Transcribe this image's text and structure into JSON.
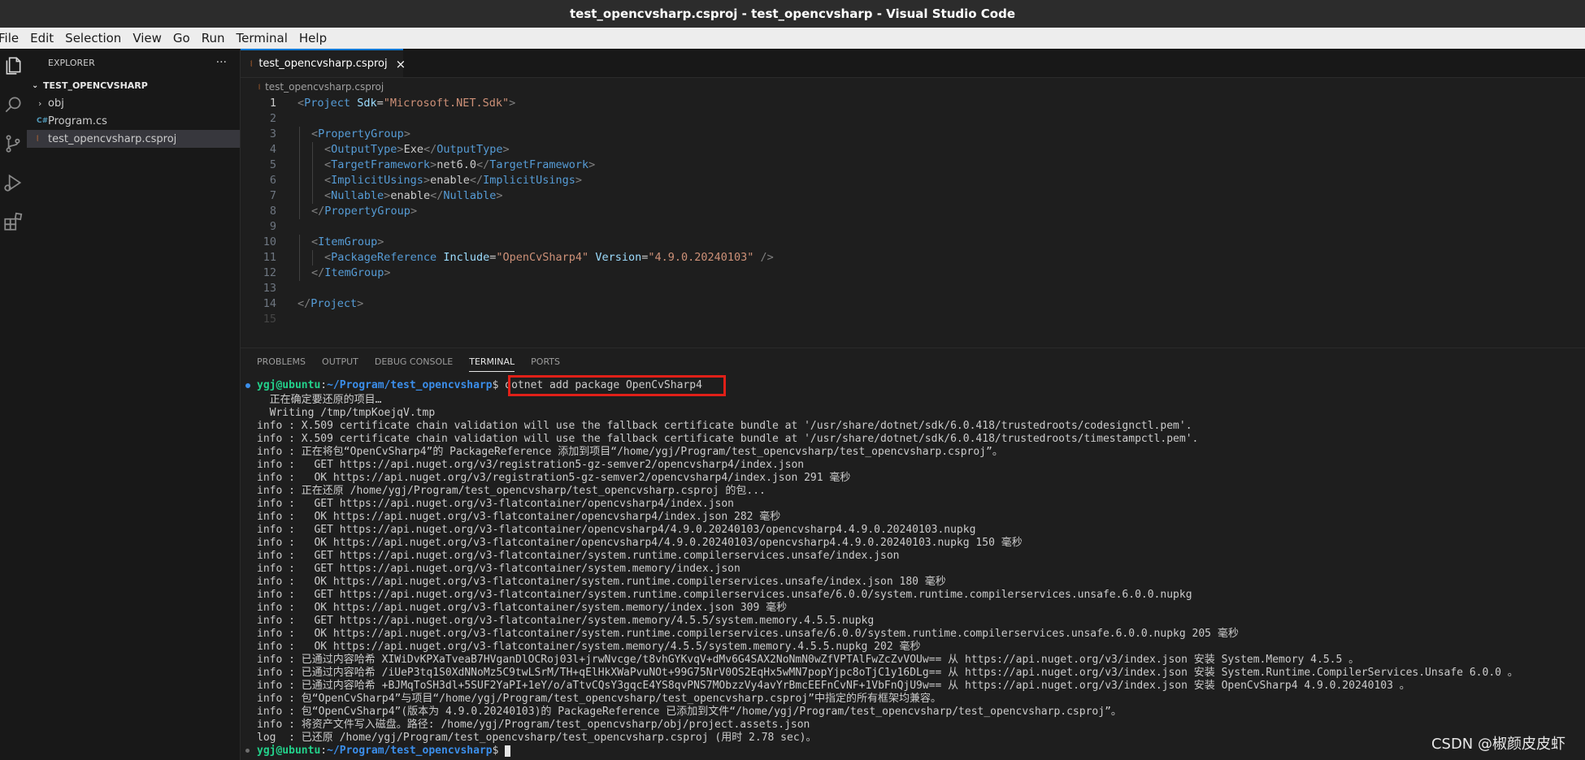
{
  "window": {
    "title": "test_opencvsharp.csproj - test_opencvsharp - Visual Studio Code"
  },
  "menu": [
    "File",
    "Edit",
    "Selection",
    "View",
    "Go",
    "Run",
    "Terminal",
    "Help"
  ],
  "activity_bar": [
    "files-icon",
    "search-icon",
    "source-control-icon",
    "run-debug-icon",
    "extensions-icon"
  ],
  "explorer": {
    "title": "EXPLORER",
    "more": "···",
    "project": "TEST_OPENCVSHARP",
    "items": [
      {
        "label": "obj",
        "icon": "chevron-right-icon"
      },
      {
        "label": "Program.cs",
        "icon": "csharp-file-icon"
      },
      {
        "label": "test_opencvsharp.csproj",
        "icon": "rss-file-icon"
      }
    ]
  },
  "editor": {
    "tab_label": "test_opencvsharp.csproj",
    "tab_close": "×",
    "breadcrumb": "test_opencvsharp.csproj",
    "lines": [
      {
        "n": "1",
        "active": true
      },
      {
        "n": "2"
      },
      {
        "n": "3"
      },
      {
        "n": "4"
      },
      {
        "n": "5"
      },
      {
        "n": "6"
      },
      {
        "n": "7"
      },
      {
        "n": "8"
      },
      {
        "n": "9"
      },
      {
        "n": "10"
      },
      {
        "n": "11"
      },
      {
        "n": "12"
      },
      {
        "n": "13"
      },
      {
        "n": "14"
      },
      {
        "n": "15"
      }
    ],
    "code": {
      "l1_tag": "Project",
      "l1_attr": "Sdk",
      "l1_val": "\"Microsoft.NET.Sdk\"",
      "l3_tag": "PropertyGroup",
      "l4_tag": "OutputType",
      "l4_text": "Exe",
      "l5_tag": "TargetFramework",
      "l5_text": "net6.0",
      "l6_tag": "ImplicitUsings",
      "l6_text": "enable",
      "l7_tag": "Nullable",
      "l7_text": "enable",
      "l8_tag": "PropertyGroup",
      "l10_tag": "ItemGroup",
      "l11_tag": "PackageReference",
      "l11_attr1": "Include",
      "l11_val1": "\"OpenCvSharp4\"",
      "l11_attr2": "Version",
      "l11_val2": "\"4.9.0.20240103\"",
      "l12_tag": "ItemGroup",
      "l14_tag": "Project"
    }
  },
  "panel": {
    "tabs": [
      "PROBLEMS",
      "OUTPUT",
      "DEBUG CONSOLE",
      "TERMINAL",
      "PORTS"
    ],
    "active_tab": "TERMINAL"
  },
  "terminal": {
    "prompt_user": "ygj@ubuntu",
    "prompt_path": "~/Program/test_opencvsharp",
    "prompt_sym": "$ ",
    "command": "dotnet add package OpenCvSharp4",
    "output": [
      "  正在确定要还原的项目…",
      "  Writing /tmp/tmpKoejqV.tmp",
      "info : X.509 certificate chain validation will use the fallback certificate bundle at '/usr/share/dotnet/sdk/6.0.418/trustedroots/codesignctl.pem'.",
      "info : X.509 certificate chain validation will use the fallback certificate bundle at '/usr/share/dotnet/sdk/6.0.418/trustedroots/timestampctl.pem'.",
      "info : 正在将包“OpenCvSharp4”的 PackageReference 添加到项目“/home/ygj/Program/test_opencvsharp/test_opencvsharp.csproj”。",
      "info :   GET https://api.nuget.org/v3/registration5-gz-semver2/opencvsharp4/index.json",
      "info :   OK https://api.nuget.org/v3/registration5-gz-semver2/opencvsharp4/index.json 291 毫秒",
      "info : 正在还原 /home/ygj/Program/test_opencvsharp/test_opencvsharp.csproj 的包...",
      "info :   GET https://api.nuget.org/v3-flatcontainer/opencvsharp4/index.json",
      "info :   OK https://api.nuget.org/v3-flatcontainer/opencvsharp4/index.json 282 毫秒",
      "info :   GET https://api.nuget.org/v3-flatcontainer/opencvsharp4/4.9.0.20240103/opencvsharp4.4.9.0.20240103.nupkg",
      "info :   OK https://api.nuget.org/v3-flatcontainer/opencvsharp4/4.9.0.20240103/opencvsharp4.4.9.0.20240103.nupkg 150 毫秒",
      "info :   GET https://api.nuget.org/v3-flatcontainer/system.runtime.compilerservices.unsafe/index.json",
      "info :   GET https://api.nuget.org/v3-flatcontainer/system.memory/index.json",
      "info :   OK https://api.nuget.org/v3-flatcontainer/system.runtime.compilerservices.unsafe/index.json 180 毫秒",
      "info :   GET https://api.nuget.org/v3-flatcontainer/system.runtime.compilerservices.unsafe/6.0.0/system.runtime.compilerservices.unsafe.6.0.0.nupkg",
      "info :   OK https://api.nuget.org/v3-flatcontainer/system.memory/index.json 309 毫秒",
      "info :   GET https://api.nuget.org/v3-flatcontainer/system.memory/4.5.5/system.memory.4.5.5.nupkg",
      "info :   OK https://api.nuget.org/v3-flatcontainer/system.runtime.compilerservices.unsafe/6.0.0/system.runtime.compilerservices.unsafe.6.0.0.nupkg 205 毫秒",
      "info :   OK https://api.nuget.org/v3-flatcontainer/system.memory/4.5.5/system.memory.4.5.5.nupkg 202 毫秒",
      "info : 已通过内容哈希 XIWiDvKPXaTveaB7HVganDlOCRoj03l+jrwNvcge/t8vhGYKvqV+dMv6G4SAX2NoNmN0wZfVPTAlFwZcZvVOUw== 从 https://api.nuget.org/v3/index.json 安装 System.Memory 4.5.5 。",
      "info : 已通过内容哈希 /iUeP3tq1S0XdNNoMz5C9twLSrM/TH+qElHkXWaPvuNOt+99G75NrV0OS2EqHx5wMN7popYjpc8oTjC1y16DLg== 从 https://api.nuget.org/v3/index.json 安装 System.Runtime.CompilerServices.Unsafe 6.0.0 。",
      "info : 已通过内容哈希 +BJMqToSH3dl+5SUF2YaPI+1eY/o/aTtvCQsY3gqcE4YS8qvPNS7MObzzVy4avYrBmcEEFnCvNF+1VbFnQjU9w== 从 https://api.nuget.org/v3/index.json 安装 OpenCvSharp4 4.9.0.20240103 。",
      "info : 包“OpenCvSharp4”与项目“/home/ygj/Program/test_opencvsharp/test_opencvsharp.csproj”中指定的所有框架均兼容。",
      "info : 包“OpenCvSharp4”(版本为 4.9.0.20240103)的 PackageReference 已添加到文件“/home/ygj/Program/test_opencvsharp/test_opencvsharp.csproj”。",
      "info : 将资产文件写入磁盘。路径: /home/ygj/Program/test_opencvsharp/obj/project.assets.json",
      "log  : 已还原 /home/ygj/Program/test_opencvsharp/test_opencvsharp.csproj (用时 2.78 sec)。"
    ]
  },
  "watermark": "CSDN @椒颜皮皮虾",
  "colors": {
    "accent": "#0078d4",
    "highlight_box": "#e02018",
    "prompt_green": "#23d18b",
    "prompt_blue": "#3b8eea"
  }
}
